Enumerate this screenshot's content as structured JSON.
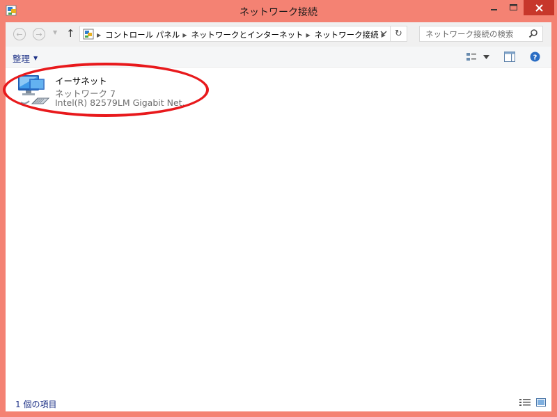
{
  "window": {
    "title": "ネットワーク接続",
    "frame_color": "#f48273",
    "close_color": "#c7372b"
  },
  "nav": {
    "back_icon": "back-arrow-icon",
    "forward_icon": "forward-arrow-icon",
    "up_icon": "up-arrow-icon",
    "breadcrumbs": [
      "コントロール パネル",
      "ネットワークとインターネット",
      "ネットワーク接続"
    ],
    "search_placeholder": "ネットワーク接続の検索"
  },
  "toolbar": {
    "organize_label": "整理"
  },
  "items": [
    {
      "name": "イーサネット",
      "network": "ネットワーク  7",
      "adapter": "Intel(R) 82579LM Gigabit Net..."
    }
  ],
  "status": {
    "item_count": "1 個の項目"
  },
  "accent_color": "#1e3287",
  "highlight_color": "#e8191c"
}
